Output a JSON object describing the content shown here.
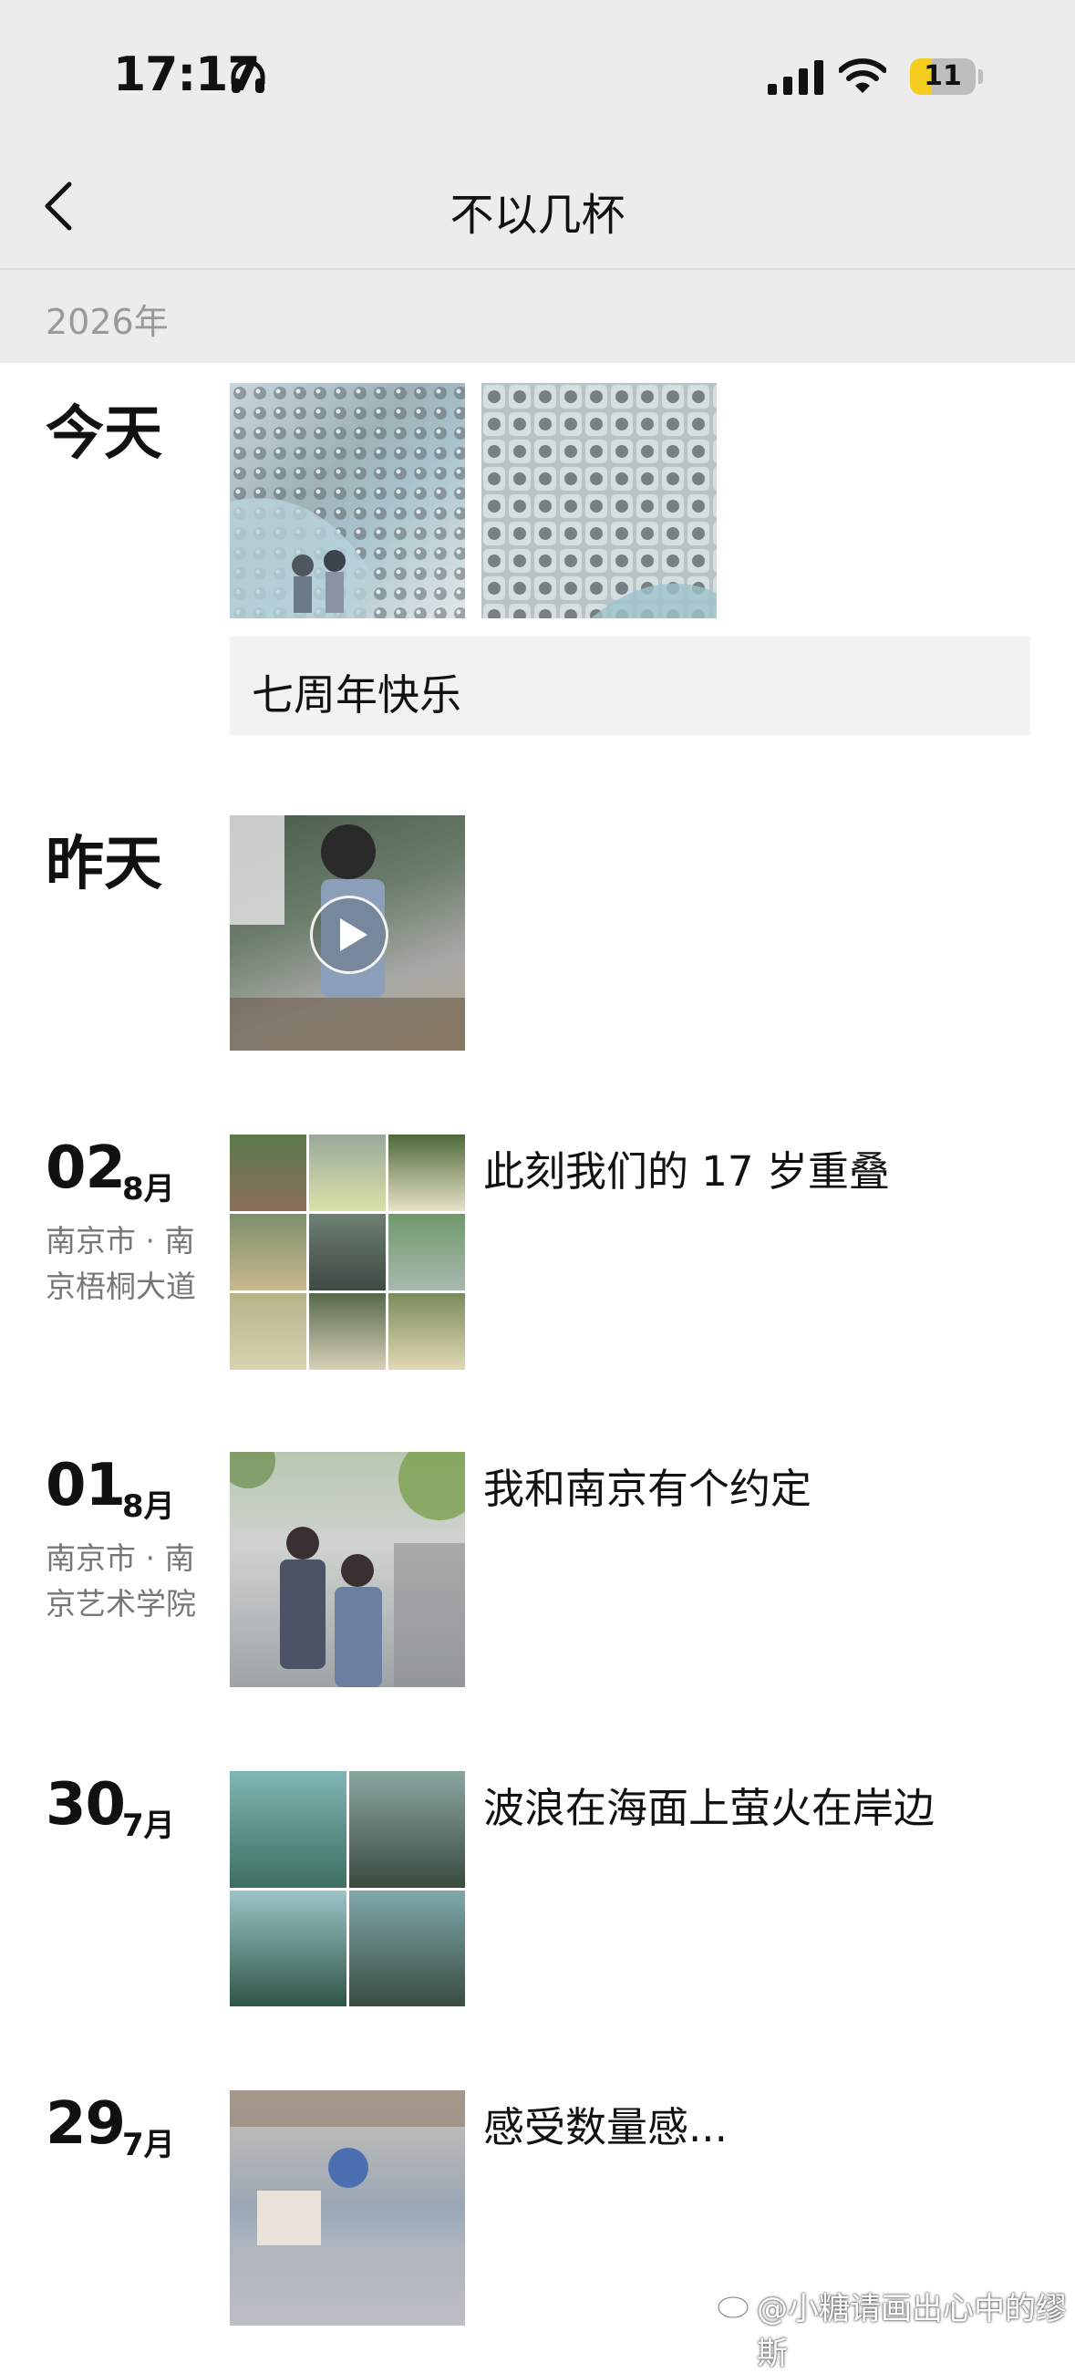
{
  "status": {
    "time": "17:17",
    "battery": "11",
    "battery_level": 0.11
  },
  "nav": {
    "title": "不以几杯"
  },
  "year_label": "2026年",
  "entries": [
    {
      "day": "今天",
      "text": "七周年快乐"
    },
    {
      "day": "昨天"
    },
    {
      "date": "02",
      "month": "8月",
      "location": "南京市 · 南京梧桐大道",
      "caption": "此刻我们的 17 岁重叠"
    },
    {
      "date": "01",
      "month": "8月",
      "location": "南京市 · 南京艺术学院",
      "caption": "我和南京有个约定"
    },
    {
      "date": "30",
      "month": "7月",
      "caption": "波浪在海面上萤火在岸边"
    },
    {
      "date": "29",
      "month": "7月",
      "caption": "感受数量感..."
    }
  ],
  "watermark": "@小糖请画出心中的缪斯",
  "icons": [
    "headphones-icon",
    "signal-icon",
    "wifi-icon",
    "battery-icon",
    "back-arrow-icon",
    "play-icon",
    "weibo-icon"
  ]
}
